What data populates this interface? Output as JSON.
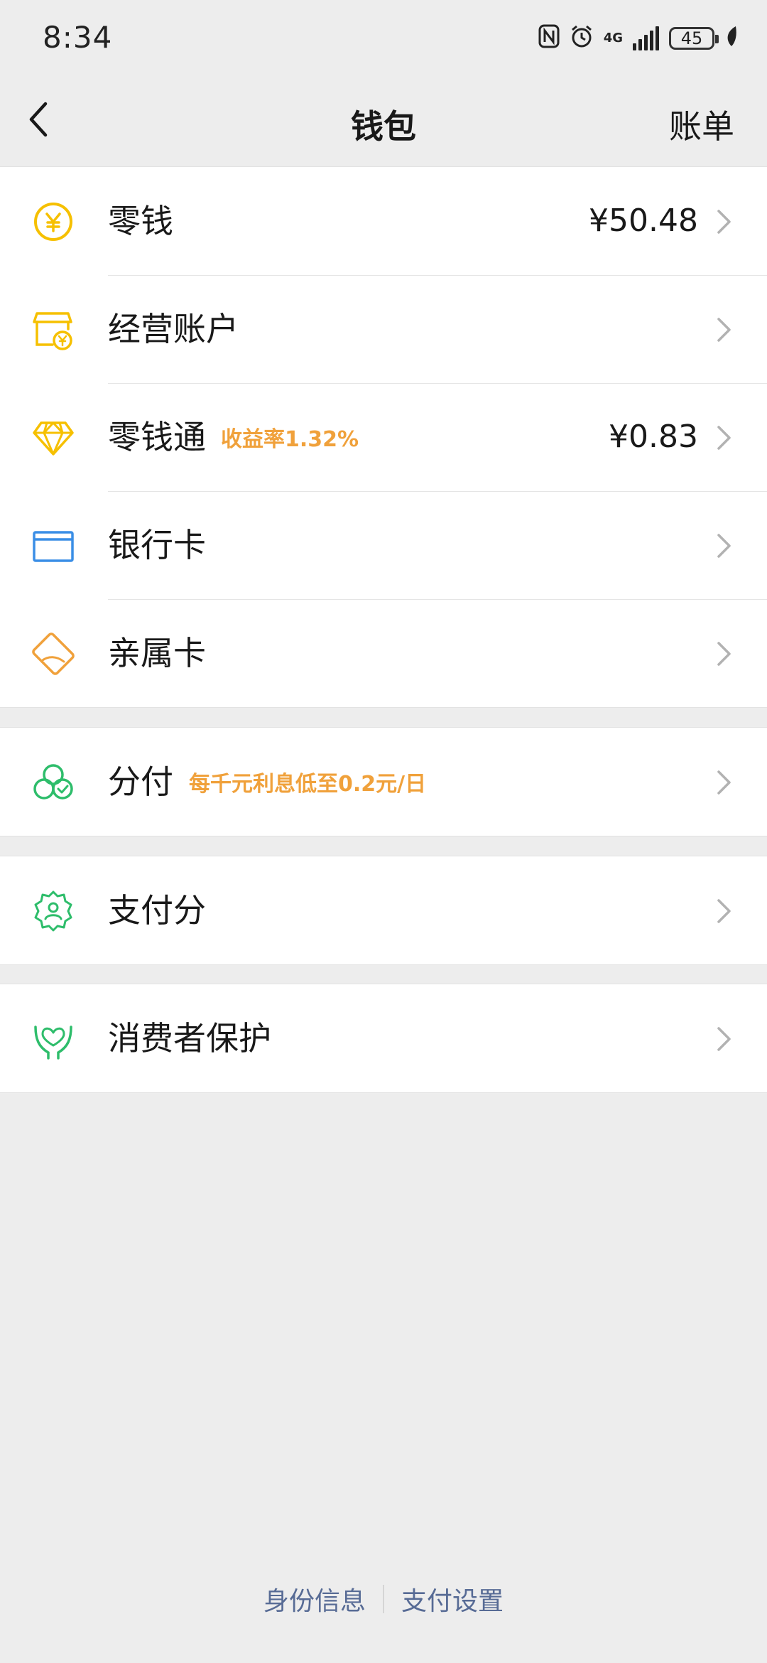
{
  "status_bar": {
    "time": "8:34",
    "network": "4G",
    "battery": "45"
  },
  "nav": {
    "title": "钱包",
    "action": "账单"
  },
  "groups": [
    {
      "items": [
        {
          "label": "零钱",
          "value": "¥50.48",
          "icon": "yen-coin-icon",
          "color": "#f6c000"
        },
        {
          "label": "经营账户",
          "icon": "store-icon",
          "color": "#f6c000"
        },
        {
          "label": "零钱通",
          "badge": "收益率1.32%",
          "value": "¥0.83",
          "icon": "diamond-icon",
          "color": "#f6c000"
        },
        {
          "label": "银行卡",
          "icon": "bank-card-icon",
          "color": "#3a8ee6"
        },
        {
          "label": "亲属卡",
          "icon": "family-card-icon",
          "color": "#f0a13b"
        }
      ]
    },
    {
      "items": [
        {
          "label": "分付",
          "badge": "每千元利息低至0.2元/日",
          "icon": "fenfu-icon",
          "color": "#2ebd6b"
        }
      ]
    },
    {
      "items": [
        {
          "label": "支付分",
          "icon": "pay-score-icon",
          "color": "#2ebd6b"
        }
      ]
    },
    {
      "items": [
        {
          "label": "消费者保护",
          "icon": "consumer-protection-icon",
          "color": "#2ebd6b"
        }
      ]
    }
  ],
  "footer": {
    "identity": "身份信息",
    "settings": "支付设置"
  },
  "colors": {
    "background": "#ededed",
    "badge": "#f0a13b",
    "link": "#576b95"
  }
}
